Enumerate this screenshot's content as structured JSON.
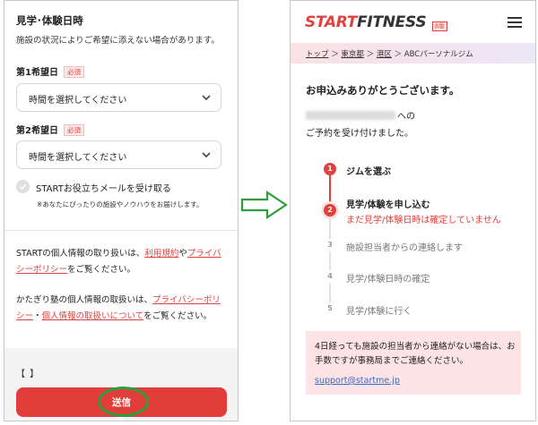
{
  "left_form": {
    "section_title": "見学･体験日時",
    "section_desc": "施設の状況によりご希望に添えない場合があります。",
    "choice1": {
      "label": "第1希望日",
      "required": "必須",
      "value": "時間を選択してください"
    },
    "choice2": {
      "label": "第2希望日",
      "required": "必須",
      "value": "時間を選択してください"
    },
    "newsletter": {
      "label": "STARTお役立ちメールを受け取る",
      "note": "※あなたにぴったりの施設やノウハウをお届けします。"
    },
    "privacy1": {
      "pre": "STARTの個人情報の取り扱いは、",
      "link1": "利用規約",
      "mid": "や",
      "link2": "プライバシーポリシー",
      "post": "をご覧ください。"
    },
    "privacy2": {
      "pre": "かたぎり塾の個人情報の取扱いは、",
      "link1": "プライバシーポリシー",
      "mid": "・",
      "link2": "個人情報の取扱いについて",
      "post": "をご覧ください。"
    },
    "cut_text": "【 】",
    "submit_label": "送信"
  },
  "right_page": {
    "brand_start": "START",
    "brand_fitness": "FITNESS",
    "beta_badge": "β版",
    "breadcrumb": {
      "home": "トップ",
      "pref": "東京都",
      "ward": "港区",
      "current": "ABCパーソナルジム",
      "sep": " ＞ "
    },
    "thanks": "お申込みありがとうございます。",
    "after_blur": "への",
    "accepted": "ご予約を受け付けました。",
    "steps": [
      {
        "num": "1",
        "label": "ジムを選ぶ"
      },
      {
        "num": "2",
        "label": "見学/体験を申し込む",
        "sub": "まだ見学/体験日時は確定していません"
      },
      {
        "num": "3",
        "label": "施設担当者からの連絡します"
      },
      {
        "num": "4",
        "label": "見学/体験日時の確定"
      },
      {
        "num": "5",
        "label": "見学/体験に行く"
      }
    ],
    "notice": "4日経っても施設の担当者から連絡がない場合は、お手数ですが事務局までご連絡ください。",
    "email": "support@startme.jp"
  },
  "colors": {
    "accent": "#e0413e",
    "highlight": "#2e9e3a",
    "link_blue": "#3a69c7"
  },
  "icons": {
    "select_chevron": "chevron-down-icon",
    "arrow": "right-arrow-icon",
    "menu": "hamburger-menu-icon",
    "check": "check-icon"
  }
}
